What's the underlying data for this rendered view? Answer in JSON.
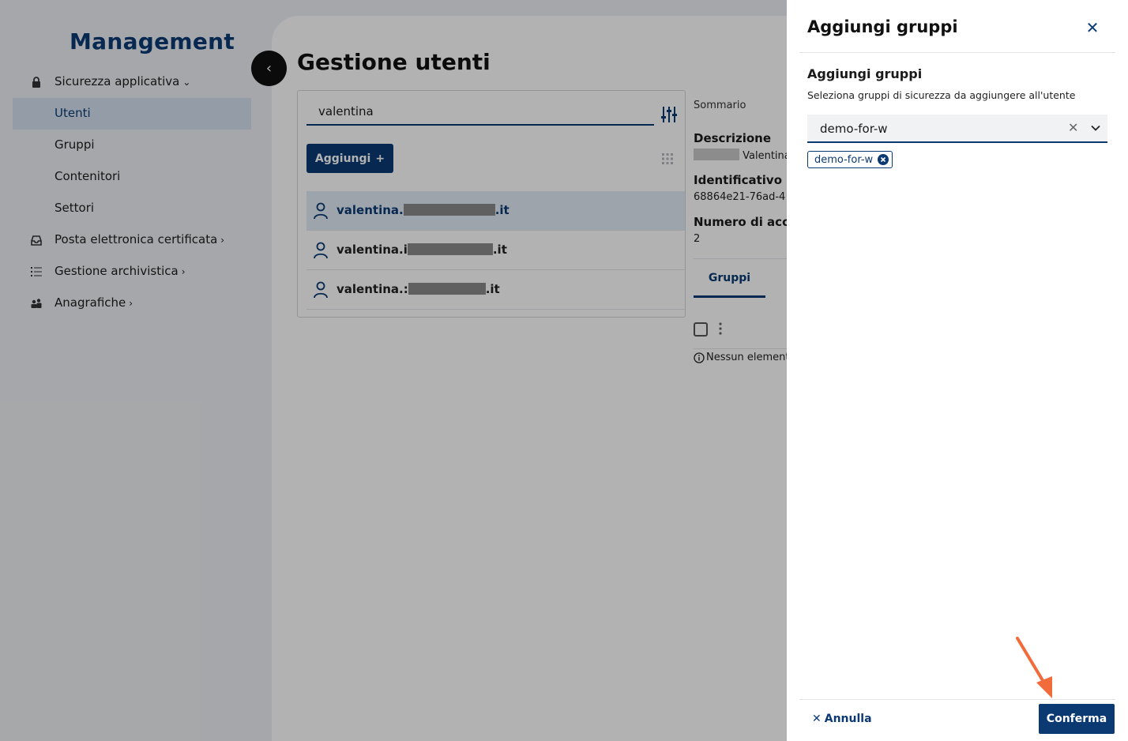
{
  "sidebar": {
    "brand": "Management",
    "items": [
      {
        "label": "Sicurezza applicativa",
        "icon": "lock-icon",
        "expanded": true
      },
      {
        "label": "Utenti",
        "active": true
      },
      {
        "label": "Gruppi"
      },
      {
        "label": "Contenitori"
      },
      {
        "label": "Settori"
      },
      {
        "label": "Posta elettronica certificata",
        "icon": "inbox-icon"
      },
      {
        "label": "Gestione archivistica",
        "icon": "list-icon"
      },
      {
        "label": "Anagrafiche",
        "icon": "people-icon"
      }
    ]
  },
  "main": {
    "title": "Gestione utenti",
    "search": {
      "value": "valentina"
    },
    "add_label": "Aggiungi",
    "users": [
      {
        "prefix": "valentina.",
        "suffix": ".it"
      },
      {
        "prefix": "valentina.i",
        "suffix": ".it"
      },
      {
        "prefix": "valentina.:",
        "suffix": ".it"
      }
    ],
    "summary": {
      "heading": "Sommario",
      "desc_label": "Descrizione",
      "desc_value": "Valentina",
      "id_label": "Identificativo un",
      "id_value": "68864e21-76ad-4",
      "access_label": "Numero di acces",
      "access_value": "2",
      "tab_label": "Gruppi",
      "empty_message": "Nessun element"
    }
  },
  "drawer": {
    "title": "Aggiungi gruppi",
    "field_title": "Aggiungi gruppi",
    "field_help": "Seleziona gruppi di sicurezza da aggiungere all'utente",
    "select_value": "demo-for-w",
    "chip_label": "demo-for-w",
    "cancel_label": "Annulla",
    "confirm_label": "Conferma"
  },
  "colors": {
    "primary": "#0b3a73",
    "sidebar_bg": "#eef0f4",
    "active_bg": "#d5e0ef",
    "annotation_arrow": "#f26b3a"
  }
}
